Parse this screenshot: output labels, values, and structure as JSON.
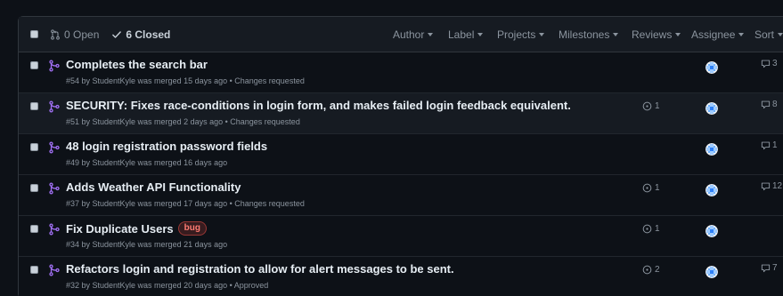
{
  "header": {
    "open_label": "0 Open",
    "closed_label": "6 Closed",
    "filters": [
      {
        "id": "author",
        "label": "Author"
      },
      {
        "id": "label",
        "label": "Label"
      },
      {
        "id": "projects",
        "label": "Projects"
      },
      {
        "id": "milestones",
        "label": "Milestones"
      },
      {
        "id": "reviews",
        "label": "Reviews"
      },
      {
        "id": "assignee",
        "label": "Assignee"
      },
      {
        "id": "sort",
        "label": "Sort"
      }
    ]
  },
  "colors": {
    "background": "#0d1117",
    "header_bg": "#161b22",
    "border": "#30363d",
    "merged_purple": "#a371f7",
    "muted_text": "#8b949e",
    "title_text": "#e6edf3",
    "bug_label": "#ff7b72"
  },
  "pull_requests": [
    {
      "title": "Completes the search bar",
      "meta": "#54 by StudentKyle was merged 15 days ago • Changes requested",
      "label": "",
      "checks": "",
      "comments": "3"
    },
    {
      "title": "SECURITY: Fixes race-conditions in login form, and makes failed login feedback equivalent.",
      "meta": "#51 by StudentKyle was merged 2 days ago • Changes requested",
      "label": "",
      "checks": "1",
      "comments": "8"
    },
    {
      "title": "48 login registration password fields",
      "meta": "#49 by StudentKyle was merged 16 days ago",
      "label": "",
      "checks": "",
      "comments": "1"
    },
    {
      "title": "Adds Weather API Functionality",
      "meta": "#37 by StudentKyle was merged 17 days ago • Changes requested",
      "label": "",
      "checks": "1",
      "comments": "12"
    },
    {
      "title": "Fix Duplicate Users",
      "meta": "#34 by StudentKyle was merged 21 days ago",
      "label": "bug",
      "checks": "1",
      "comments": ""
    },
    {
      "title": "Refactors login and registration to allow for alert messages to be sent.",
      "meta": "#32 by StudentKyle was merged 20 days ago • Approved",
      "label": "",
      "checks": "2",
      "comments": "7"
    }
  ]
}
